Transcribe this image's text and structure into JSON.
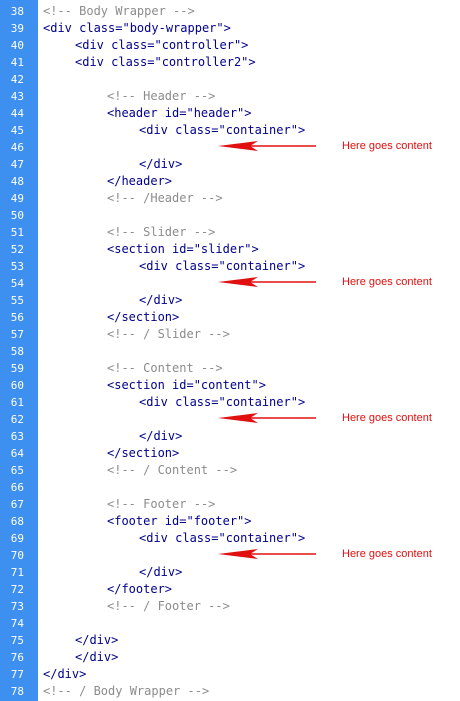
{
  "lines": [
    {
      "n": "38",
      "indent": 0,
      "text": "<!-- Body Wrapper -->",
      "kind": "comment"
    },
    {
      "n": "39",
      "indent": 0,
      "text": "<div class=\"body-wrapper\">",
      "kind": "tag"
    },
    {
      "n": "40",
      "indent": 1,
      "text": "<div class=\"controller\">",
      "kind": "tag"
    },
    {
      "n": "41",
      "indent": 1,
      "text": "<div class=\"controller2\">",
      "kind": "tag"
    },
    {
      "n": "42",
      "indent": 0,
      "text": "",
      "kind": "blank"
    },
    {
      "n": "43",
      "indent": 2,
      "text": "<!-- Header -->",
      "kind": "comment"
    },
    {
      "n": "44",
      "indent": 2,
      "text": "<header id=\"header\">",
      "kind": "tag"
    },
    {
      "n": "45",
      "indent": 3,
      "text": "<div class=\"container\">",
      "kind": "tag"
    },
    {
      "n": "46",
      "indent": 0,
      "text": "",
      "kind": "blank"
    },
    {
      "n": "47",
      "indent": 3,
      "text": "</div>",
      "kind": "tag"
    },
    {
      "n": "48",
      "indent": 2,
      "text": "</header>",
      "kind": "tag"
    },
    {
      "n": "49",
      "indent": 2,
      "text": "<!-- /Header -->",
      "kind": "comment"
    },
    {
      "n": "50",
      "indent": 0,
      "text": "",
      "kind": "blank"
    },
    {
      "n": "51",
      "indent": 2,
      "text": "<!-- Slider -->",
      "kind": "comment"
    },
    {
      "n": "52",
      "indent": 2,
      "text": "<section id=\"slider\">",
      "kind": "tag"
    },
    {
      "n": "53",
      "indent": 3,
      "text": "<div class=\"container\">",
      "kind": "tag"
    },
    {
      "n": "54",
      "indent": 0,
      "text": "",
      "kind": "blank"
    },
    {
      "n": "55",
      "indent": 3,
      "text": "</div>",
      "kind": "tag"
    },
    {
      "n": "56",
      "indent": 2,
      "text": "</section>",
      "kind": "tag"
    },
    {
      "n": "57",
      "indent": 2,
      "text": "<!-- / Slider -->",
      "kind": "comment"
    },
    {
      "n": "58",
      "indent": 0,
      "text": "",
      "kind": "blank"
    },
    {
      "n": "59",
      "indent": 2,
      "text": "<!-- Content -->",
      "kind": "comment"
    },
    {
      "n": "60",
      "indent": 2,
      "text": "<section id=\"content\">",
      "kind": "tag"
    },
    {
      "n": "61",
      "indent": 3,
      "text": "<div class=\"container\">",
      "kind": "tag"
    },
    {
      "n": "62",
      "indent": 0,
      "text": "",
      "kind": "blank"
    },
    {
      "n": "63",
      "indent": 3,
      "text": "</div>",
      "kind": "tag"
    },
    {
      "n": "64",
      "indent": 2,
      "text": "</section>",
      "kind": "tag"
    },
    {
      "n": "65",
      "indent": 2,
      "text": "<!-- / Content -->",
      "kind": "comment"
    },
    {
      "n": "66",
      "indent": 0,
      "text": "",
      "kind": "blank"
    },
    {
      "n": "67",
      "indent": 2,
      "text": "<!-- Footer -->",
      "kind": "comment"
    },
    {
      "n": "68",
      "indent": 2,
      "text": "<footer id=\"footer\">",
      "kind": "tag"
    },
    {
      "n": "69",
      "indent": 3,
      "text": "<div class=\"container\">",
      "kind": "tag"
    },
    {
      "n": "70",
      "indent": 0,
      "text": "",
      "kind": "blank"
    },
    {
      "n": "71",
      "indent": 3,
      "text": "</div>",
      "kind": "tag"
    },
    {
      "n": "72",
      "indent": 2,
      "text": "</footer>",
      "kind": "tag"
    },
    {
      "n": "73",
      "indent": 2,
      "text": "<!-- / Footer -->",
      "kind": "comment"
    },
    {
      "n": "74",
      "indent": 0,
      "text": "",
      "kind": "blank"
    },
    {
      "n": "75",
      "indent": 1,
      "text": "</div>",
      "kind": "tag"
    },
    {
      "n": "76",
      "indent": 1,
      "text": "</div>",
      "kind": "tag"
    },
    {
      "n": "77",
      "indent": 0,
      "text": "</div>",
      "kind": "tag"
    },
    {
      "n": "78",
      "indent": 0,
      "text": "<!-- / Body Wrapper -->",
      "kind": "comment"
    }
  ],
  "annotations": [
    {
      "line": "46",
      "label": "Here goes content"
    },
    {
      "line": "54",
      "label": "Here goes content"
    },
    {
      "line": "62",
      "label": "Here goes content"
    },
    {
      "line": "70",
      "label": "Here goes content"
    }
  ],
  "colors": {
    "gutter": "#3d8ff0",
    "line_number": "#ffffff",
    "tag": "#00008b",
    "comment": "#8c8c8c",
    "annotation": "#e01010"
  }
}
